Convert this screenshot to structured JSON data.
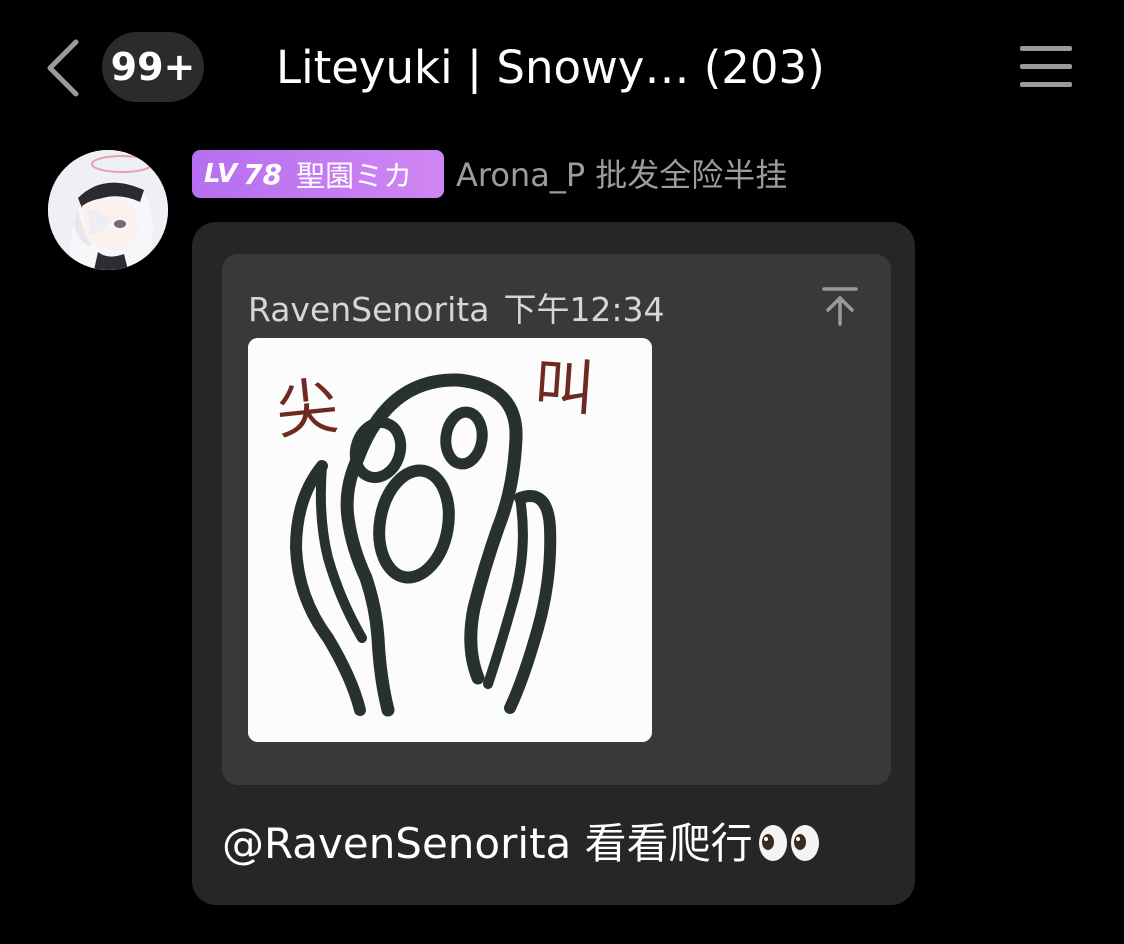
{
  "header": {
    "unread_count": "99+",
    "title": "Liteyuki | Snowy… (203)"
  },
  "message": {
    "level_prefix": "LV",
    "level": "78",
    "nickname": "聖園ミカ",
    "sender": "Arona_P 批发全险半挂",
    "quote": {
      "author": "RavenSenorita",
      "time": "下午12:34",
      "image_text_left": "尖",
      "image_text_right": "叫"
    },
    "text": "@RavenSenorita 看看爬行"
  },
  "icons": {
    "back": "chevron-left-icon",
    "menu": "hamburger-menu-icon",
    "jump": "jump-to-original-icon",
    "emoji": "eyes-emoji-icon"
  },
  "colors": {
    "background": "#000000",
    "bubble": "#262626",
    "quote": "#393939",
    "badge_gradient_start": "#b66ff0",
    "badge_gradient_end": "#d086f2",
    "sender_name": "#9c9c9c"
  }
}
